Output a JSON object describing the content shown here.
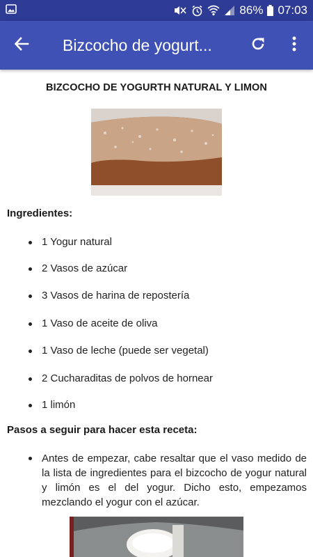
{
  "status_bar": {
    "battery_percent": "86%",
    "time": "07:03",
    "icons": [
      "gallery-icon",
      "mute-icon",
      "alarm-icon",
      "wifi-icon",
      "signal-icon",
      "battery-icon"
    ],
    "background_color": "#2d3b95"
  },
  "app_bar": {
    "title": "Bizcocho de yogurt...",
    "back_icon": "arrow-back-icon",
    "refresh_icon": "refresh-icon",
    "more_icon": "more-vert-icon",
    "background_color": "#3f51b5"
  },
  "recipe": {
    "title": "BIZCOCHO DE YOGURTH NATURAL Y LIMON",
    "ingredients_heading": "Ingredientes:",
    "ingredients": [
      "1 Yogur natural",
      "2 Vasos de azúcar",
      "3 Vasos de harina de repostería",
      "1 Vaso de aceite de oliva",
      "1 Vaso de leche (puede ser vegetal)",
      "2 Cucharaditas de polvos de hornear",
      "1 limón"
    ],
    "steps_heading": "Pasos a seguir para hacer esta receta:",
    "steps": [
      "Antes de empezar, cabe resaltar que el vaso medido de la lista de ingredientes para el bizcocho de yogur natural y limón es el del yogur. Dicho esto, empezamos mezclando el yogur con el azúcar."
    ]
  }
}
